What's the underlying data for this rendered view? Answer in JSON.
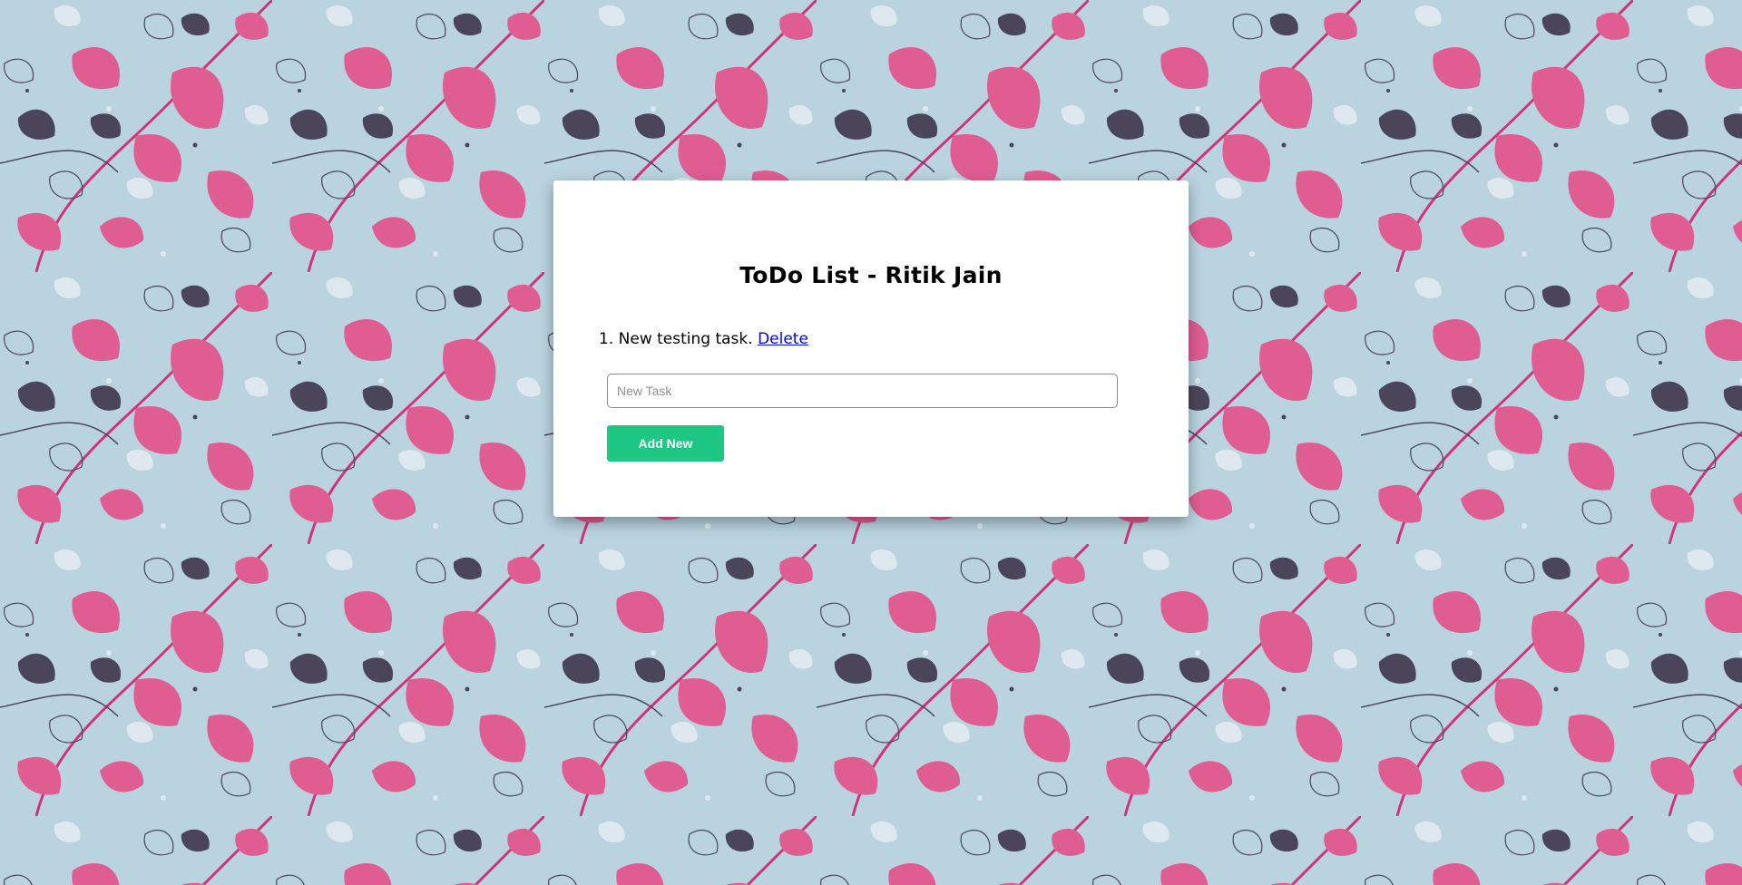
{
  "page": {
    "title": "ToDo List - Ritik Jain"
  },
  "background": {
    "color": "#b9d4df",
    "leaf_pink": "#e05d92",
    "leaf_dark": "#4a4558",
    "leaf_light": "#dfe8ee",
    "pattern": "floral-leaf-pattern"
  },
  "tasks": [
    {
      "number": "1.",
      "text": "New testing task.",
      "delete_label": "Delete"
    }
  ],
  "input": {
    "placeholder": "New Task",
    "value": ""
  },
  "add_button": {
    "label": "Add New",
    "color": "#1ec784"
  }
}
